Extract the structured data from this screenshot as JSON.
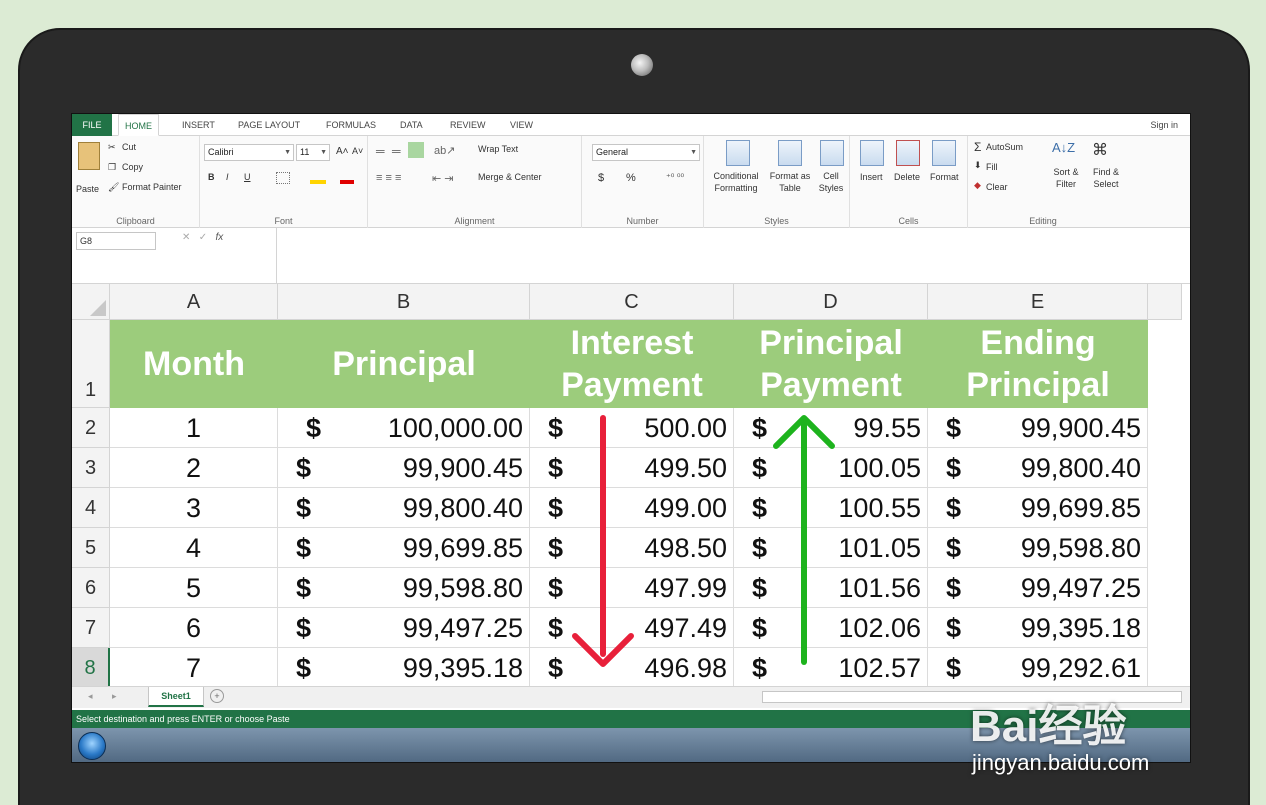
{
  "ribbon_tabs": [
    "FILE",
    "HOME",
    "INSERT",
    "PAGE LAYOUT",
    "FORMULAS",
    "DATA",
    "REVIEW",
    "VIEW"
  ],
  "sign_in": "Sign in",
  "clipboard": {
    "paste": "Paste",
    "cut": "Cut",
    "copy": "Copy",
    "format_painter": "Format Painter",
    "label": "Clipboard"
  },
  "font": {
    "name": "Calibri",
    "size": "11",
    "bold": "B",
    "italic": "I",
    "underline": "U",
    "label": "Font"
  },
  "alignment": {
    "wrap_text": "Wrap Text",
    "merge_center": "Merge & Center",
    "label": "Alignment"
  },
  "number": {
    "format": "General",
    "currency": "$",
    "percent": "%",
    "label": "Number"
  },
  "styles": {
    "conditional": "Conditional Formatting",
    "format_table": "Format as Table",
    "cell_styles": "Cell Styles",
    "label": "Styles"
  },
  "cells": {
    "insert": "Insert",
    "delete": "Delete",
    "format": "Format",
    "label": "Cells"
  },
  "editing": {
    "autosum": "AutoSum",
    "fill": "Fill",
    "clear": "Clear",
    "sort": "Sort & Filter",
    "find": "Find & Select",
    "label": "Editing"
  },
  "name_box": "G8",
  "fx": "fx",
  "columns": [
    "A",
    "B",
    "C",
    "D",
    "E"
  ],
  "rows": [
    "1",
    "2",
    "3",
    "4",
    "5",
    "6",
    "7",
    "8"
  ],
  "headers": [
    "Month",
    "Principal",
    "Interest Payment",
    "Principal Payment",
    "Ending Principal"
  ],
  "table": [
    [
      "1",
      "100,000.00",
      "500.00",
      "99.55",
      "99,900.45"
    ],
    [
      "2",
      "99,900.45",
      "499.50",
      "100.05",
      "99,800.40"
    ],
    [
      "3",
      "99,800.40",
      "499.00",
      "100.55",
      "99,699.85"
    ],
    [
      "4",
      "99,699.85",
      "498.50",
      "101.05",
      "99,598.80"
    ],
    [
      "5",
      "99,598.80",
      "497.99",
      "101.56",
      "99,497.25"
    ],
    [
      "6",
      "99,497.25",
      "497.49",
      "102.06",
      "99,395.18"
    ],
    [
      "7",
      "99,395.18",
      "496.98",
      "102.57",
      "99,292.61"
    ]
  ],
  "currency_symbol": "$",
  "sheet_tab": "Sheet1",
  "status_text": "Select destination and press ENTER or choose Paste",
  "watermark": "Bai经验",
  "watermark_url": "jingyan.baidu.com",
  "colors": {
    "excel_green": "#217346",
    "header_fill": "#9ccc7c",
    "arrow_down": "#e8203a",
    "arrow_up": "#1db31d"
  }
}
